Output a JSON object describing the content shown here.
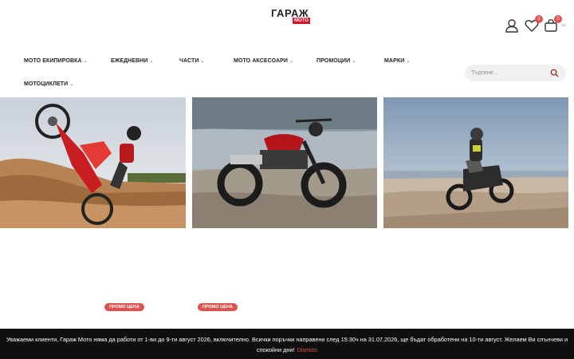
{
  "header": {
    "logo_text": "ГАРАЖ",
    "logo_tag": "МОТО",
    "wishlist_count": "0",
    "cart_count": "0",
    "icons": [
      "user-icon",
      "heart-icon",
      "cart-icon",
      "chevron-down-icon"
    ]
  },
  "nav": {
    "items": [
      {
        "label": "МОТО ЕКИПИРОВКА"
      },
      {
        "label": "ЕЖЕДНЕВНИ"
      },
      {
        "label": "ЧАСТИ"
      },
      {
        "label": "МОТО АКСЕСОАРИ"
      },
      {
        "label": "ПРОМОЦИИ"
      },
      {
        "label": "МАРКИ"
      },
      {
        "label": "МОТОЦИКЛЕТИ"
      }
    ]
  },
  "search": {
    "placeholder": "Търсене..."
  },
  "tiles": [
    {
      "subject": "red dirt bike wheelie on sandy hill"
    },
    {
      "subject": "red scrambler motorcycle by frozen lake"
    },
    {
      "subject": "adventure motorcycle rider on beach"
    }
  ],
  "promo": {
    "label": "ПРОМО ЦЕНА"
  },
  "notice": {
    "text": "Уважаеми клиенти, Гараж Мото няма да работи от 1-ви до 9-ти август 2026, включително. Всички поръчки направени след 15:30ч на 31.07.2026, ще бъдат обработени на 10-ти август. Желаем Ви слънчеви и спокойни дни!",
    "dismiss": "Dismiss"
  },
  "colors": {
    "accent": "#e0524a",
    "promo": "#d9534f",
    "notice_bg": "#0f0f0f",
    "logo_red": "#d0142c"
  }
}
